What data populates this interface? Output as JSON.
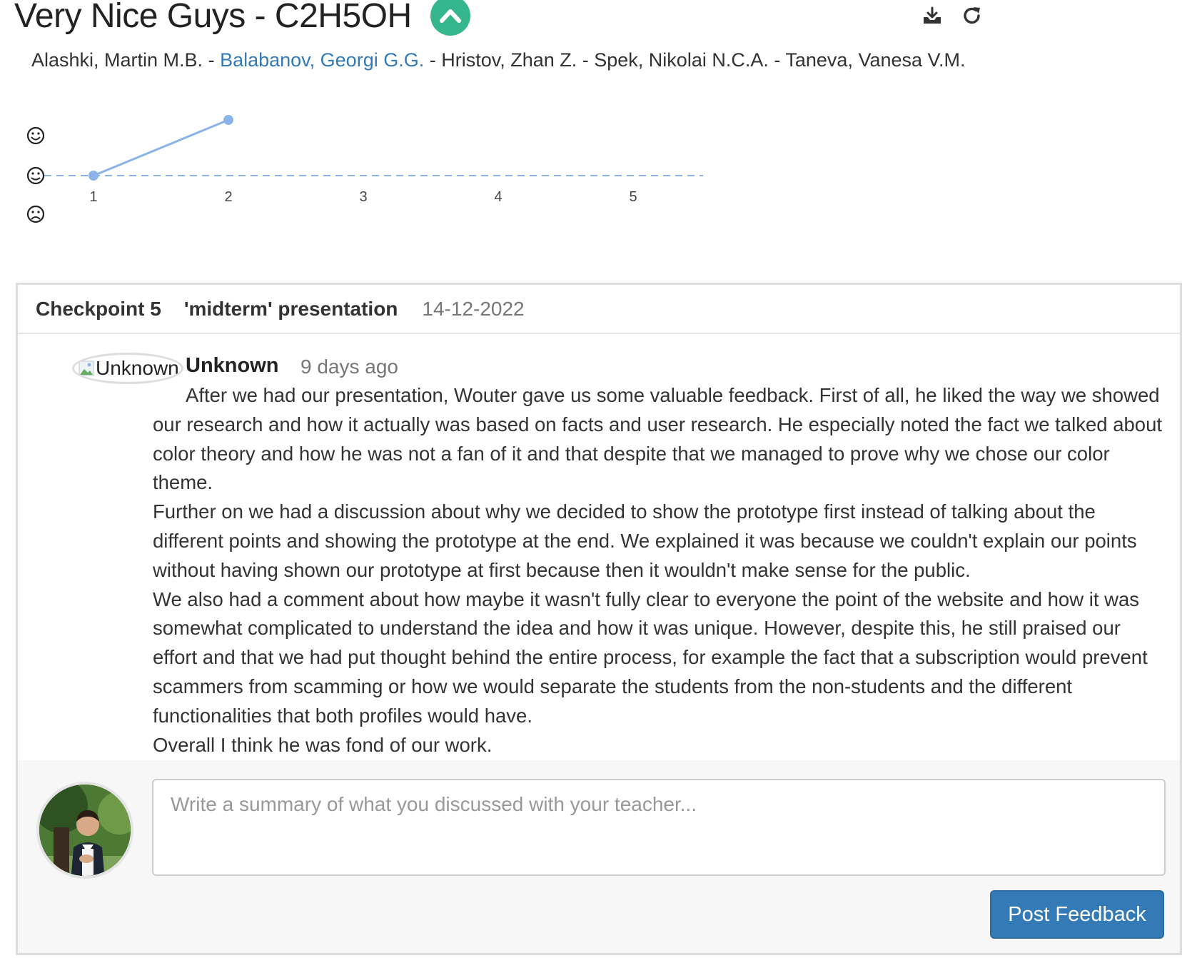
{
  "header": {
    "title": "Very Nice Guys - C2H5OH",
    "collapse_icon": "chevron-up-icon",
    "actions": [
      {
        "icon": "download-icon"
      },
      {
        "icon": "refresh-icon"
      }
    ]
  },
  "members": [
    {
      "name": "Alashki, Martin M.B.",
      "highlighted": false
    },
    {
      "name": "Balabanov, Georgi G.G.",
      "highlighted": true
    },
    {
      "name": "Hristov, Zhan Z.",
      "highlighted": false
    },
    {
      "name": "Spek, Nikolai N.C.A.",
      "highlighted": false
    },
    {
      "name": "Taneva, Vanesa V.M.",
      "highlighted": false
    }
  ],
  "member_separator": " - ",
  "chart_data": {
    "type": "line",
    "x": [
      1,
      2
    ],
    "y": [
      0,
      1
    ],
    "xticks": [
      "1",
      "2",
      "3",
      "4",
      "5"
    ],
    "xlim": [
      1,
      5
    ],
    "ylim": [
      -1,
      1
    ],
    "yticks": [
      "happy-face-icon",
      "neutral-face-icon",
      "sad-face-icon"
    ],
    "baseline": 0,
    "baseline_style": "dashed",
    "color": "#8ab4e8"
  },
  "checkpoint": {
    "label": "Checkpoint 5",
    "title": "'midterm' presentation",
    "date": "14-12-2022",
    "feedback": {
      "avatar_alt": "Unknown",
      "author": "Unknown",
      "time": "9 days ago",
      "paragraphs": [
        "After we had our presentation, Wouter gave us some valuable feedback. First of all, he liked the way we showed our research and how it actually was based on facts and user research. He especially noted the fact we talked about color theory and how he was not a fan of it and that despite that we managed to prove why we chose our color theme.",
        "Further on we had a discussion about why we decided to show the prototype first instead of talking about the different points and showing the prototype at the end. We explained it was because we couldn't explain our points without having shown our prototype at first because then it wouldn't make sense for the public.",
        "We also had a comment about how maybe it wasn't fully clear to everyone the point of the website and how it was somewhat complicated to understand the idea and how it was unique. However, despite this, he still praised our effort and that we had put thought behind the entire process, for example the fact that a subscription would prevent scammers from scamming or how we would separate the students from the non-students and the different functionalities that both profiles would have.",
        "Overall I think he was fond of our work."
      ]
    },
    "reply": {
      "placeholder": "Write a summary of what you discussed with your teacher...",
      "value": "",
      "submit_label": "Post Feedback"
    }
  },
  "colors": {
    "accent": "#337ab7",
    "collapse_button": "#36b68c",
    "chart_line": "#8ab4e8"
  }
}
